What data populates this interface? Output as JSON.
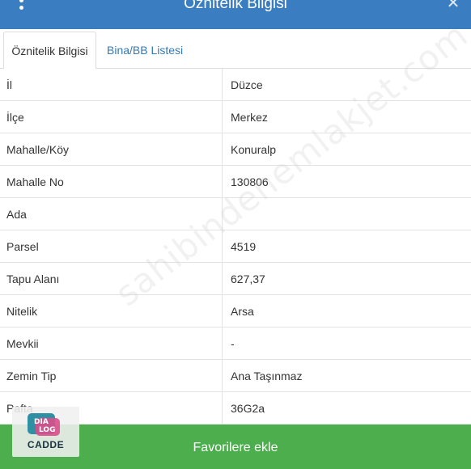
{
  "header": {
    "title": "Öznitelik Bilgisi",
    "menu_icon": "more-vertical-icon",
    "close_icon": "close-icon",
    "close_glyph": "✕",
    "background_color": "#3b7dc1"
  },
  "tabs": [
    {
      "label": "Öznitelik Bilgisi",
      "active": true
    },
    {
      "label": "Bina/BB Listesi",
      "active": false
    }
  ],
  "attributes": [
    {
      "key": "İl",
      "value": "Düzce"
    },
    {
      "key": "İlçe",
      "value": "Merkez"
    },
    {
      "key": "Mahalle/Köy",
      "value": "Konuralp"
    },
    {
      "key": "Mahalle No",
      "value": "130806"
    },
    {
      "key": "Ada",
      "value": ""
    },
    {
      "key": "Parsel",
      "value": "4519"
    },
    {
      "key": "Tapu Alanı",
      "value": "627,37"
    },
    {
      "key": "Nitelik",
      "value": "Arsa"
    },
    {
      "key": "Mevkii",
      "value": "-"
    },
    {
      "key": "Zemin Tip",
      "value": "Ana Taşınmaz"
    },
    {
      "key": "Pafta",
      "value": "36G2a"
    }
  ],
  "watermark": {
    "text": "sahibindenemlakjet.com"
  },
  "favorite_button": {
    "label": "Favorilere ekle",
    "color": "#4cae4c"
  },
  "logo": {
    "top_text": "DIA",
    "bottom_text": "LOG",
    "caption": "CADDE"
  }
}
